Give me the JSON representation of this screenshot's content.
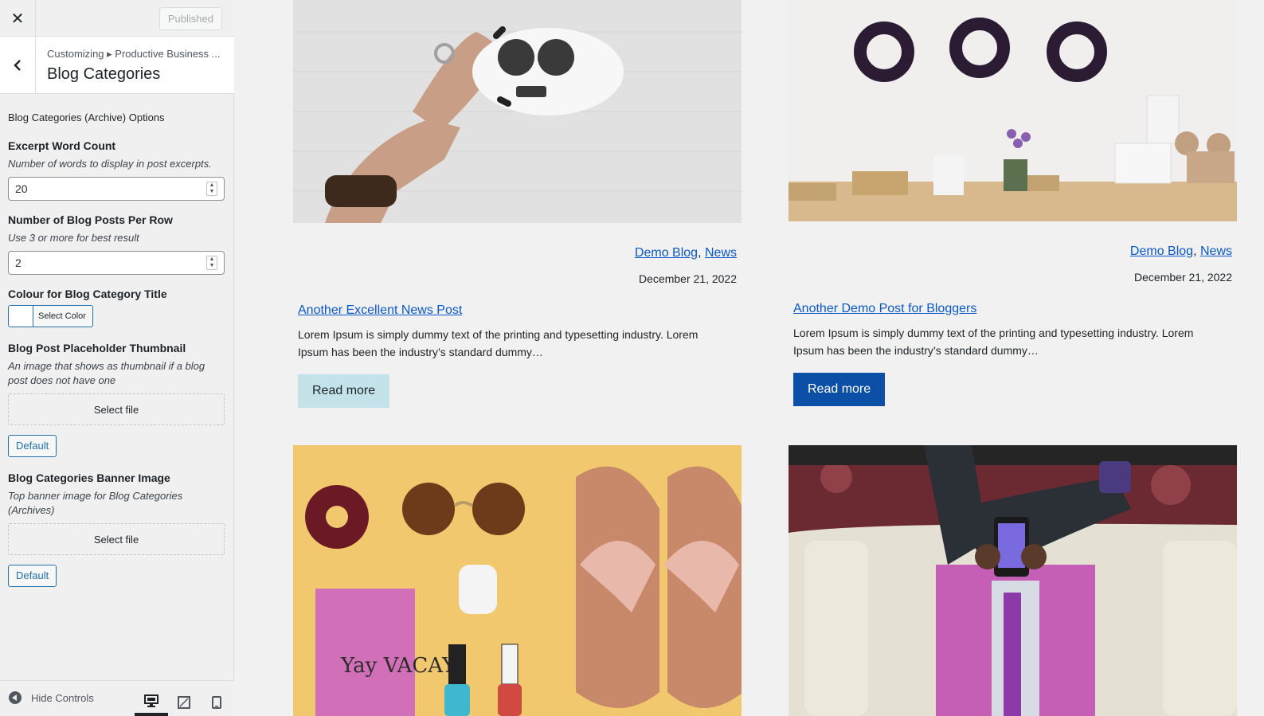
{
  "topbar": {
    "close_icon": "close-icon",
    "publish_label": "Published"
  },
  "section": {
    "breadcrumb": "Customizing ▸ Productive Business ...",
    "title": "Blog Categories"
  },
  "controls": {
    "heading": "Blog Categories (Archive) Options",
    "excerpt_count": {
      "title": "Excerpt Word Count",
      "desc": "Number of words to display in post excerpts.",
      "value": "20"
    },
    "posts_per_row": {
      "title": "Number of Blog Posts Per Row",
      "desc": "Use 3 or more for best result",
      "value": "2"
    },
    "title_colour": {
      "title": "Colour for Blog Category Title",
      "button": "Select Color",
      "swatch": "#ffffff"
    },
    "placeholder_thumb": {
      "title": "Blog Post Placeholder Thumbnail",
      "desc": "An image that shows as thumbnail if a blog post does not have one",
      "select": "Select file",
      "default": "Default"
    },
    "banner": {
      "title": "Blog Categories Banner Image",
      "desc": "Top banner image for Blog Categories (Archives)",
      "select": "Select file",
      "default": "Default"
    }
  },
  "footer": {
    "hide_label": "Hide Controls",
    "devices": [
      "desktop-icon",
      "tablet-icon",
      "mobile-icon"
    ],
    "active_device": "desktop"
  },
  "posts": [
    {
      "cat1": "Demo Blog",
      "cat2": "News",
      "sep": ",",
      "date": "December 21, 2022",
      "title": "Another Excellent News Post",
      "excerpt": "Lorem Ipsum is simply dummy text of the printing and typesetting industry. Lorem Ipsum has been the industry’s standard dummy…",
      "read_more": "Read more",
      "image": "hand-holding-drone-controller"
    },
    {
      "cat1": "Demo Blog",
      "cat2": "News",
      "sep": ",",
      "date": "December 21, 2022",
      "title": "Another Demo Post for Bloggers",
      "excerpt": "Lorem Ipsum is simply dummy text of the printing and typesetting industry. Lorem Ipsum has been the industry’s standard dummy…",
      "read_more": "Read more",
      "image": "shop-shelf-with-wreaths"
    },
    {
      "image": "flat-lay-summer-items",
      "image_text": "Yay VACAY"
    },
    {
      "image": "man-on-sofa-with-phone"
    }
  ],
  "colors": {
    "link": "#0a58ca",
    "read_more_light": "#c4e2e9",
    "read_more_dark": "#0b4fa6",
    "wp_blue": "#2271b1"
  }
}
